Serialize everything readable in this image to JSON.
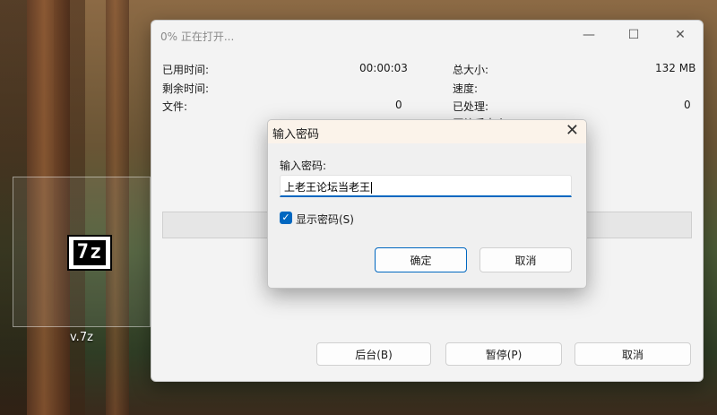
{
  "desktop": {
    "file_label": "v.7z",
    "icon_text": "7z"
  },
  "main_window": {
    "title": "0% 正在打开...",
    "controls": {
      "minimize": "—",
      "maximize": "☐",
      "close": "✕"
    },
    "left_info": [
      {
        "label": "已用时间:",
        "value": "00:00:03"
      },
      {
        "label": "剩余时间:",
        "value": ""
      },
      {
        "label": "文件:",
        "value": "0"
      }
    ],
    "right_info": [
      {
        "label": "总大小:",
        "value": "132 MB"
      },
      {
        "label": "速度:",
        "value": ""
      },
      {
        "label": "已处理:",
        "value": "0"
      },
      {
        "label": "压缩后大小:",
        "value": ""
      }
    ],
    "progress_percent": 0,
    "buttons": {
      "background": "后台(B)",
      "pause": "暂停(P)",
      "cancel": "取消"
    }
  },
  "password_dialog": {
    "title": "输入密码",
    "close": "✕",
    "prompt": "输入密码:",
    "password_value": "上老王论坛当老王",
    "show_password": {
      "label": "显示密码(S)",
      "checked": true,
      "check_glyph": "✓"
    },
    "buttons": {
      "ok": "确定",
      "cancel": "取消"
    }
  }
}
